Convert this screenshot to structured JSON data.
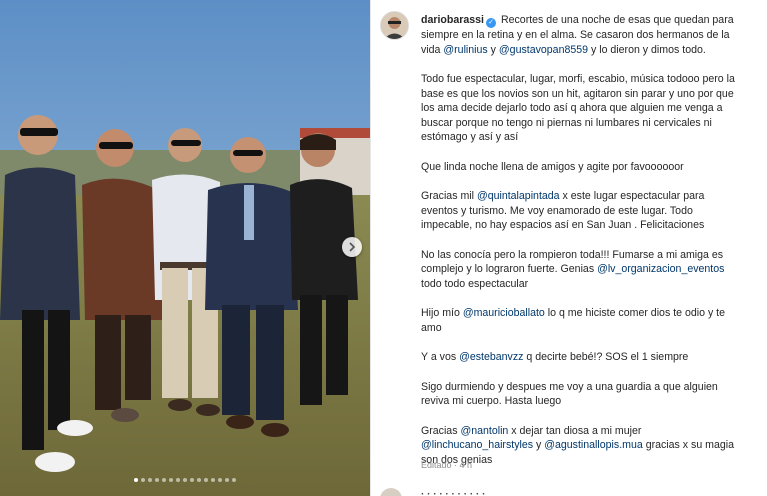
{
  "post": {
    "username": "dariobarassi",
    "intro": "Recortes de una noche de esas que quedan para siempre en la retina y en el alma. Se casaron dos hermanos de la vida",
    "mention_1": "@rulinius",
    "y_1": "y",
    "mention_2": "@gustavopan8559",
    "intro_end": "y lo dieron y dimos todo.",
    "p2": "Todo fue espectacular, lugar, morfi, escabio, música todooo pero la base es que los novios son un hit, agitaron sin parar y uno por que los ama decide dejarlo todo así q ahora que alguien me venga a buscar porque no tengo ni piernas ni lumbares ni cervicales ni estómago y así y así",
    "p3": "Que linda noche llena de amigos y agite por favoooooor",
    "p4_a": "Gracias mil",
    "p4_mention": "@quintalapintada",
    "p4_b": "x este lugar espectacular para eventos y turismo. Me voy enamorado de este lugar. Todo impecable, no hay espacios así en San Juan . Felicitaciones",
    "p5_a": "No las conocía pero la rompieron toda!!! Fumarse a mi amiga es complejo y lo lograron fuerte. Genias",
    "p5_mention": "@lv_organizacion_eventos",
    "p5_b": "todo todo espectacular",
    "p6_a": "Hijo mío",
    "p6_mention": "@mauricioballato",
    "p6_b": "lo q me hiciste comer dios te odio y te amo",
    "p7_a": "Y a vos",
    "p7_mention": "@estebanvzz",
    "p7_b": "q decirte bebé!? SOS el 1 siempre",
    "p8": "Sigo durmiendo y despues me voy a una guardia a que alguien reviva mi cuerpo. Hasta luego",
    "p9_a": "Gracias",
    "p9_mention_1": "@nantolin",
    "p9_b": "x dejar tan diosa a mi mujer",
    "p9_mention_2": "@linchucano_hairstyles",
    "p9_y": "y",
    "p9_mention_3": "@agustinallopis.mua",
    "p9_c": "gracias x su magia son dos genias",
    "edited": "Editado",
    "time": "4 h"
  },
  "carousel": {
    "dot_count": 15,
    "active_index": 0
  },
  "next_comment": {
    "text": "· · · · · · · · · · ·"
  },
  "colors": {
    "mention": "#00376b",
    "verified": "#3897f0"
  },
  "icons": {
    "next": "chevron-right-icon",
    "verified": "verified-badge-icon"
  }
}
